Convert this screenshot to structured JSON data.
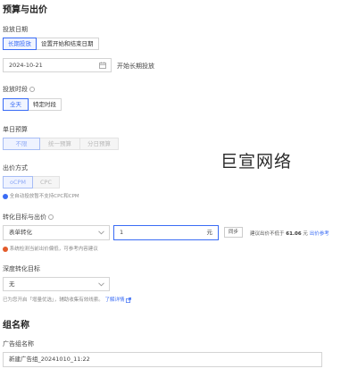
{
  "budget_section": {
    "title": "预算与出价",
    "schedule": {
      "label": "投放日期",
      "options": [
        "长期投放",
        "设置开始和结束日期"
      ],
      "selected": "长期投放",
      "date_value": "2024-10-21",
      "date_suffix": "开始长期投放"
    },
    "time_slot": {
      "label": "投放时段",
      "options": [
        "全天",
        "特定时段"
      ],
      "selected": "全天"
    },
    "unit_budget": {
      "label": "单日预算",
      "options": [
        "不限",
        "统一预算",
        "分日预算"
      ],
      "selected": "不限"
    },
    "bid_method": {
      "label": "出价方式",
      "options": [
        "oCPM",
        "CPC"
      ],
      "selected": "oCPM",
      "note": "全自动投放暂不支持CPC和CPM"
    },
    "conversion": {
      "label": "转化目标与出价",
      "goal_value": "表单转化",
      "bid_value": "1",
      "bid_unit": "元",
      "copy_button": "同步",
      "suggest_prefix": "建议出价不低于",
      "suggest_value": "61.06",
      "suggest_unit": "元",
      "suggest_link": "出价参考",
      "warning": "系统检测当前出价偏低，可参考内容建议"
    },
    "deep_conversion": {
      "label": "深度转化目标",
      "value": "无",
      "note": "已为您开启「增量优选」，辅助收集有效线索。",
      "note_link": "了解详情"
    }
  },
  "group_section": {
    "title": "组名称",
    "field_label": "广告组名称",
    "field_value": "新建广告组_20241010_11:22"
  },
  "watermark": "巨宣网络",
  "colors": {
    "accent": "#3a6cf5",
    "warning": "#e35b2a"
  }
}
